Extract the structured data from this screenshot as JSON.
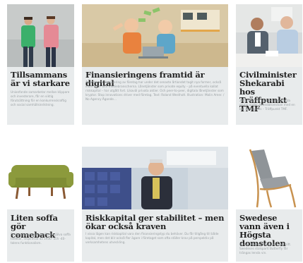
{
  "articles": [
    {
      "title": "Tillsammans är vi starkare",
      "excerpt": "Unionfonde samarbetar mellan klippare och investerare, får en viktig förutsättning för en konkurrenskraftig och social samhällsinriktning."
    },
    {
      "title": "Finansieringens framtid är digital",
      "excerpt": "Ägande och finansiering av företag har under det senaste årtiondet tagit nya former, också inom tech- och mediebranscherna. Lånetjänster som private equity – på eventuella kallat riskkapital – har utgått fort. Likaväl privata aktier. Och peer-to-peer, digitala lånetjänster som kryptor. Stop innovations driver med företag. Text: Roland Westholt. Illustration: Malin Amer. / No Agency Ägande…"
    },
    {
      "title": "Civilminister Shekarabi hos Träffpunkt TMF",
      "excerpt": "2016 sag TMF tagit en annorlunda grupp under Almedalsveckan med en bar mötesplats – Träffpunkt TMF."
    },
    {
      "title": "Liten soffa gör comeback",
      "excerpt": "Design fra kommer im fllom, själva soffa tilldelar, inspirerad av 1930- och -40-talens funktionalism."
    },
    {
      "title": "Riskkapital ger stabilitet – men ökar också kraven",
      "excerpt": "I vissa lägen kan riskkapital vara den finansieringstyp du behöver. Du får tillgång till både kapital, men det blir också fler ägare i företaget som ofta ställer krav på perspektiv på verksamhetens utveckling."
    },
    {
      "title": "Swedese vann även i Högsta domstolen",
      "excerpt": "Nu har Högsta domstolen sagt sitt. Swedeses stolsparti Butterfly får trängas lensla vin."
    }
  ],
  "colors": {
    "card_bg": "#e8ebec",
    "title": "#222222",
    "excerpt": "#9aa0a3",
    "green_shirt": "#3bb06b",
    "pink_shirt": "#e58a95",
    "sofa_green": "#8c9a3c",
    "illustration_orange": "#e9823e"
  }
}
